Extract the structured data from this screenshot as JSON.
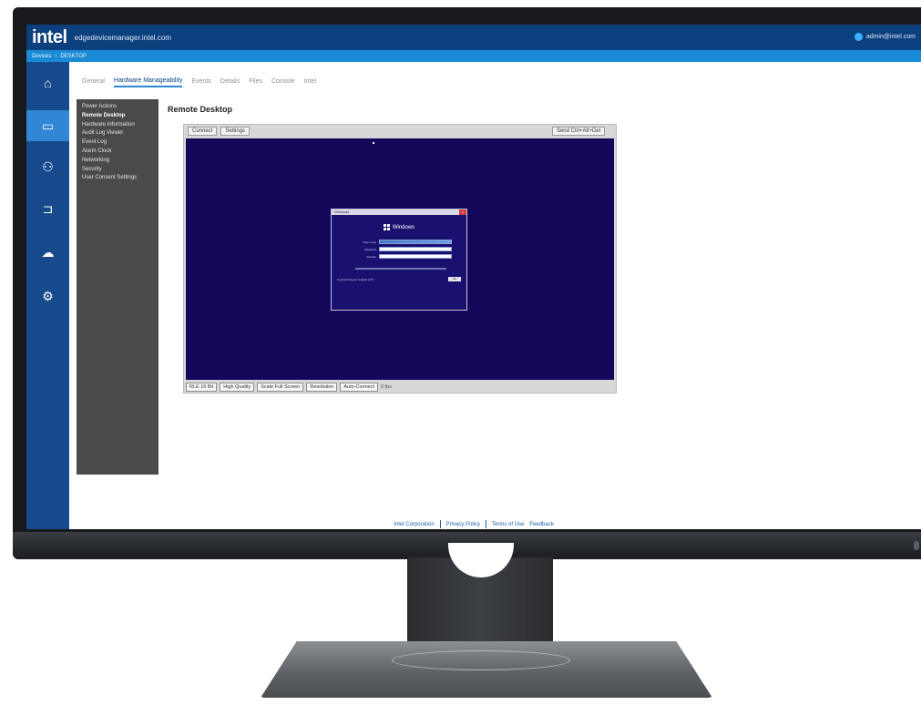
{
  "header": {
    "brand": "intel",
    "app_title": "edgedevicemanager.intel.com",
    "user_label": "admin@intel.com"
  },
  "breadcrumb": {
    "items": [
      "Devices",
      "›",
      "DESKTOP"
    ]
  },
  "icon_rail": [
    {
      "icon": "home-icon",
      "glyph": "⌂"
    },
    {
      "icon": "monitor-icon",
      "glyph": "▭",
      "active": true
    },
    {
      "icon": "users-icon",
      "glyph": "⚇"
    },
    {
      "icon": "kvm-icon",
      "glyph": "⊐"
    },
    {
      "icon": "cloud-upload-icon",
      "glyph": "☁"
    },
    {
      "icon": "settings-icon",
      "glyph": "⚙"
    }
  ],
  "tabs": [
    {
      "label": "General"
    },
    {
      "label": "Hardware Manageability",
      "active": true
    },
    {
      "label": "Events"
    },
    {
      "label": "Details"
    },
    {
      "label": "Files"
    },
    {
      "label": "Console"
    },
    {
      "label": "Intel"
    }
  ],
  "submenu": {
    "items": [
      {
        "label": "Power Actions"
      },
      {
        "label": "Remote Desktop",
        "active": true
      },
      {
        "label": "Hardware Information"
      },
      {
        "label": "Audit Log Viewer"
      },
      {
        "label": "Event Log"
      },
      {
        "label": "Alarm Clock"
      },
      {
        "label": "Networking"
      },
      {
        "label": "Security"
      },
      {
        "label": "User Consent Settings"
      }
    ]
  },
  "panel": {
    "title": "Remote Desktop"
  },
  "viewer": {
    "connect_label": "Connect",
    "settings_label": "Settings",
    "send_keys_label": "Send Ctrl+Alt+Del",
    "encoding_value": "RLE 16 Bit",
    "quality_value": "High Quality",
    "scale_value": "Scale Full Screen",
    "view_value": "Resolution",
    "autoconnect_label": "Auto-Connect",
    "status_label": "0 fps",
    "login": {
      "bar_title": "Windows",
      "close_glyph": "×",
      "brand_text": "Windows",
      "username_label": "User name",
      "password_label": "Password",
      "domain_label": "Domain",
      "footnote": "Keyboard layout: English (US)",
      "ok_label": "OK"
    }
  },
  "footer": {
    "links": [
      "Intel Corporation",
      "Privacy Policy",
      "Terms of Use",
      "Feedback"
    ]
  },
  "colors": {
    "topbar": "#0b3f7d",
    "crumb": "#1b8ad6",
    "rail": "#174a8c",
    "rail_active": "#2f87d6",
    "submenu": "#4a4a4a",
    "remote_screen": "#14075a"
  }
}
